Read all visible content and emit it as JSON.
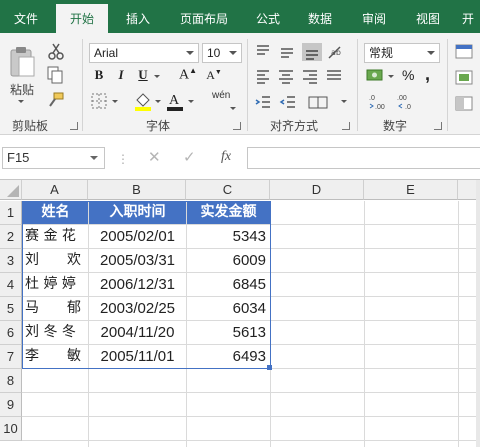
{
  "ribbon_tabs": [
    "文件",
    "开始",
    "插入",
    "页面布局",
    "公式",
    "数据",
    "审阅",
    "视图",
    "开"
  ],
  "active_tab": "开始",
  "clipboard": {
    "paste_label": "粘贴",
    "group_label": "剪贴板"
  },
  "font": {
    "name": "Arial",
    "size": "10",
    "group_label": "字体",
    "bold": "B",
    "italic": "I",
    "underline": "U",
    "phonetic": "wén"
  },
  "alignment": {
    "group_label": "对齐方式"
  },
  "number": {
    "format": "常规",
    "percent": "%",
    "comma": ",",
    "group_label": "数字"
  },
  "formula_bar": {
    "name_box": "F15",
    "fx": "fx",
    "content": ""
  },
  "columns": [
    "A",
    "B",
    "C",
    "D",
    "E"
  ],
  "rows": [
    "1",
    "2",
    "3",
    "4",
    "5",
    "6",
    "7",
    "8",
    "9",
    "10"
  ],
  "table": {
    "headers": [
      "姓名",
      "入职时间",
      "实发金额"
    ],
    "rows": [
      [
        "赛 金 花",
        "2005/02/01",
        "5343"
      ],
      [
        "刘　　欢",
        "2005/03/31",
        "6009"
      ],
      [
        "杜 婷 婷",
        "2006/12/31",
        "6845"
      ],
      [
        "马　　郁",
        "2003/02/25",
        "6034"
      ],
      [
        "刘 冬 冬",
        "2004/11/20",
        "5613"
      ],
      [
        "李　　敏",
        "2005/11/01",
        "6493"
      ]
    ]
  },
  "colors": {
    "excel_green": "#217346",
    "header_blue": "#4472c4"
  }
}
